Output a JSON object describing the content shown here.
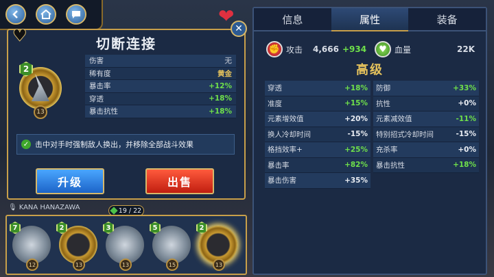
{
  "nav": {
    "back_icon": "back-arrow-icon",
    "home_icon": "home-icon",
    "chat_icon": "chat-bubble-icon"
  },
  "skill": {
    "title": "切断连接",
    "level": "2",
    "rank": "13",
    "stats": [
      {
        "label": "伤害",
        "value": "无",
        "color": "gray"
      },
      {
        "label": "稀有度",
        "value": "黄金",
        "color": "gold"
      },
      {
        "label": "暴击率",
        "value": "+12%",
        "color": "green"
      },
      {
        "label": "穿透",
        "value": "+18%",
        "color": "green"
      },
      {
        "label": "暴击抗性",
        "value": "+18%",
        "color": "green"
      }
    ],
    "effect": "击中对手时强制敌人换出，并移除全部战斗效果",
    "upgrade_label": "升级",
    "sell_label": "出售"
  },
  "voice_actor": "KANA  HANAZAWA",
  "counter": "19 / 22",
  "cards": [
    {
      "level": "7",
      "rank": "12",
      "style": "silver"
    },
    {
      "level": "2",
      "rank": "13",
      "style": "gold"
    },
    {
      "level": "3",
      "rank": "13",
      "style": "silver"
    },
    {
      "level": "5",
      "rank": "15",
      "style": "silver"
    },
    {
      "level": "2",
      "rank": "13",
      "style": "gold",
      "selected": true
    }
  ],
  "tabs": [
    {
      "label": "信息",
      "active": false
    },
    {
      "label": "属性",
      "active": true
    },
    {
      "label": "装备",
      "active": false
    }
  ],
  "attack": {
    "label": "攻击",
    "base": "4,666",
    "bonus": "+934"
  },
  "hp": {
    "label": "血量",
    "value": "22K"
  },
  "grade": "高级",
  "attributes": [
    {
      "label": "穿透",
      "value": "+18%",
      "color": "green"
    },
    {
      "label": "防御",
      "value": "+33%",
      "color": "green"
    },
    {
      "label": "准度",
      "value": "+15%",
      "color": "green"
    },
    {
      "label": "抗性",
      "value": "+0%",
      "color": "white"
    },
    {
      "label": "元素增效值",
      "value": "+20%",
      "color": "white"
    },
    {
      "label": "元素减效值",
      "value": "-11%",
      "color": "green"
    },
    {
      "label": "换人冷却时间",
      "value": "-15%",
      "color": "white"
    },
    {
      "label": "特别招式冷却时间",
      "value": "-15%",
      "color": "white"
    },
    {
      "label": "格挡效率+",
      "value": "+25%",
      "color": "green"
    },
    {
      "label": "充杀率",
      "value": "+0%",
      "color": "white"
    },
    {
      "label": "暴击率",
      "value": "+82%",
      "color": "green"
    },
    {
      "label": "暴击抗性",
      "value": "+18%",
      "color": "green"
    },
    {
      "label": "暴击伤害",
      "value": "+35%",
      "color": "white"
    }
  ],
  "colors": {
    "gold_border": "#c9a04a",
    "positive": "#6fe04a",
    "panel": "#1b2a44"
  }
}
